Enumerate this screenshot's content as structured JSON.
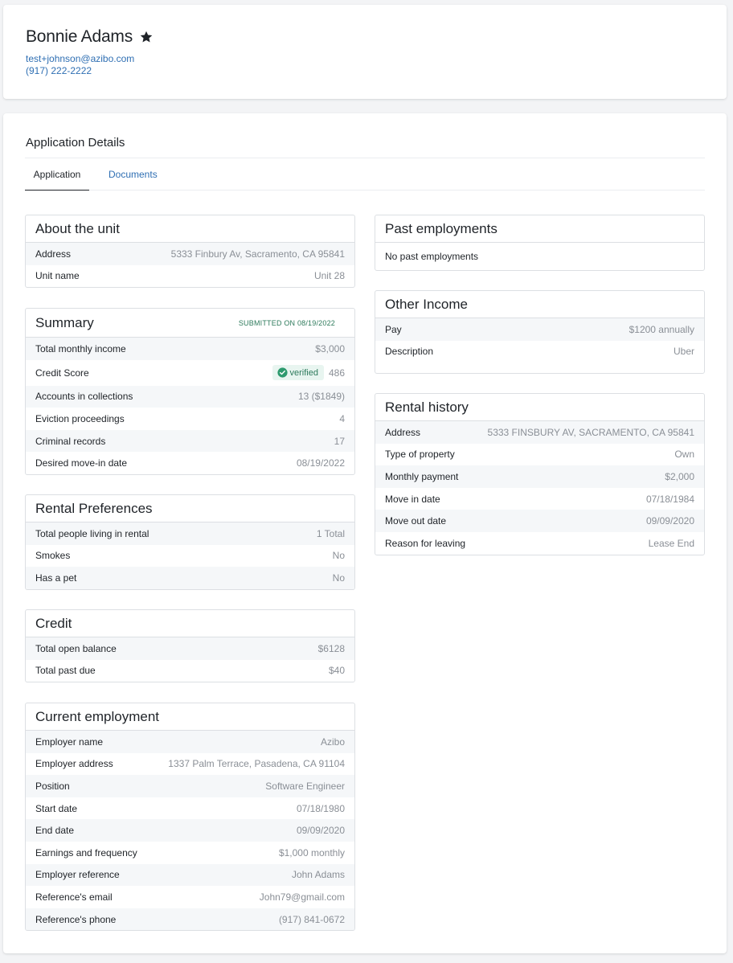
{
  "profile": {
    "name": "Bonnie Adams",
    "email": "test+johnson@azibo.com",
    "phone": "(917) 222-2222"
  },
  "details": {
    "title": "Application Details",
    "tabs": [
      {
        "label": "Application",
        "active": true
      },
      {
        "label": "Documents",
        "active": false
      }
    ]
  },
  "about_unit": {
    "title": "About the unit",
    "rows": [
      {
        "label": "Address",
        "value": "5333 Finbury Av, Sacramento, CA 95841"
      },
      {
        "label": "Unit name",
        "value": "Unit 28"
      }
    ]
  },
  "summary": {
    "title": "Summary",
    "submitted": "SUBMITTED ON 08/19/2022",
    "rows": [
      {
        "label": "Total monthly income",
        "value": "$3,000"
      },
      {
        "label": "Credit Score",
        "badge": "verified",
        "value": "486"
      },
      {
        "label": "Accounts in collections",
        "value": "13 ($1849)"
      },
      {
        "label": "Eviction proceedings",
        "value": "4"
      },
      {
        "label": "Criminal records",
        "value": "17"
      },
      {
        "label": "Desired move-in date",
        "value": "08/19/2022"
      }
    ]
  },
  "rental_preferences": {
    "title": "Rental Preferences",
    "rows": [
      {
        "label": "Total people living in rental",
        "value": "1 Total"
      },
      {
        "label": "Smokes",
        "value": "No"
      },
      {
        "label": "Has a pet",
        "value": "No"
      }
    ]
  },
  "credit": {
    "title": "Credit",
    "rows": [
      {
        "label": "Total open balance",
        "value": "$6128"
      },
      {
        "label": "Total past due",
        "value": "$40"
      }
    ]
  },
  "current_employment": {
    "title": "Current employment",
    "rows": [
      {
        "label": "Employer name",
        "value": "Azibo"
      },
      {
        "label": "Employer address",
        "value": "1337 Palm Terrace, Pasadena, CA 91104"
      },
      {
        "label": "Position",
        "value": "Software Engineer"
      },
      {
        "label": "Start date",
        "value": "07/18/1980"
      },
      {
        "label": "End date",
        "value": "09/09/2020"
      },
      {
        "label": "Earnings and frequency",
        "value": "$1,000 monthly"
      },
      {
        "label": "Employer reference",
        "value": "John Adams"
      },
      {
        "label": "Reference's email",
        "value": "John79@gmail.com"
      },
      {
        "label": "Reference's phone",
        "value": "(917) 841-0672"
      }
    ]
  },
  "past_employments": {
    "title": "Past employments",
    "empty": "No past employments"
  },
  "other_income": {
    "title": "Other Income",
    "rows": [
      {
        "label": "Pay",
        "value": "$1200 annually"
      },
      {
        "label": "Description",
        "value": "Uber"
      }
    ]
  },
  "rental_history": {
    "title": "Rental history",
    "rows": [
      {
        "label": "Address",
        "value": "5333 FINSBURY AV, SACRAMENTO, CA 95841"
      },
      {
        "label": "Type of property",
        "value": "Own"
      },
      {
        "label": "Monthly payment",
        "value": "$2,000"
      },
      {
        "label": "Move in date",
        "value": "07/18/1984"
      },
      {
        "label": "Move out date",
        "value": "09/09/2020"
      },
      {
        "label": "Reason for leaving",
        "value": "Lease End"
      }
    ]
  },
  "colors": {
    "link": "#2f6fb3",
    "verified_text": "#2d7a5b",
    "verified_bg": "#e8f5f0",
    "muted_value": "#8a8f96"
  }
}
